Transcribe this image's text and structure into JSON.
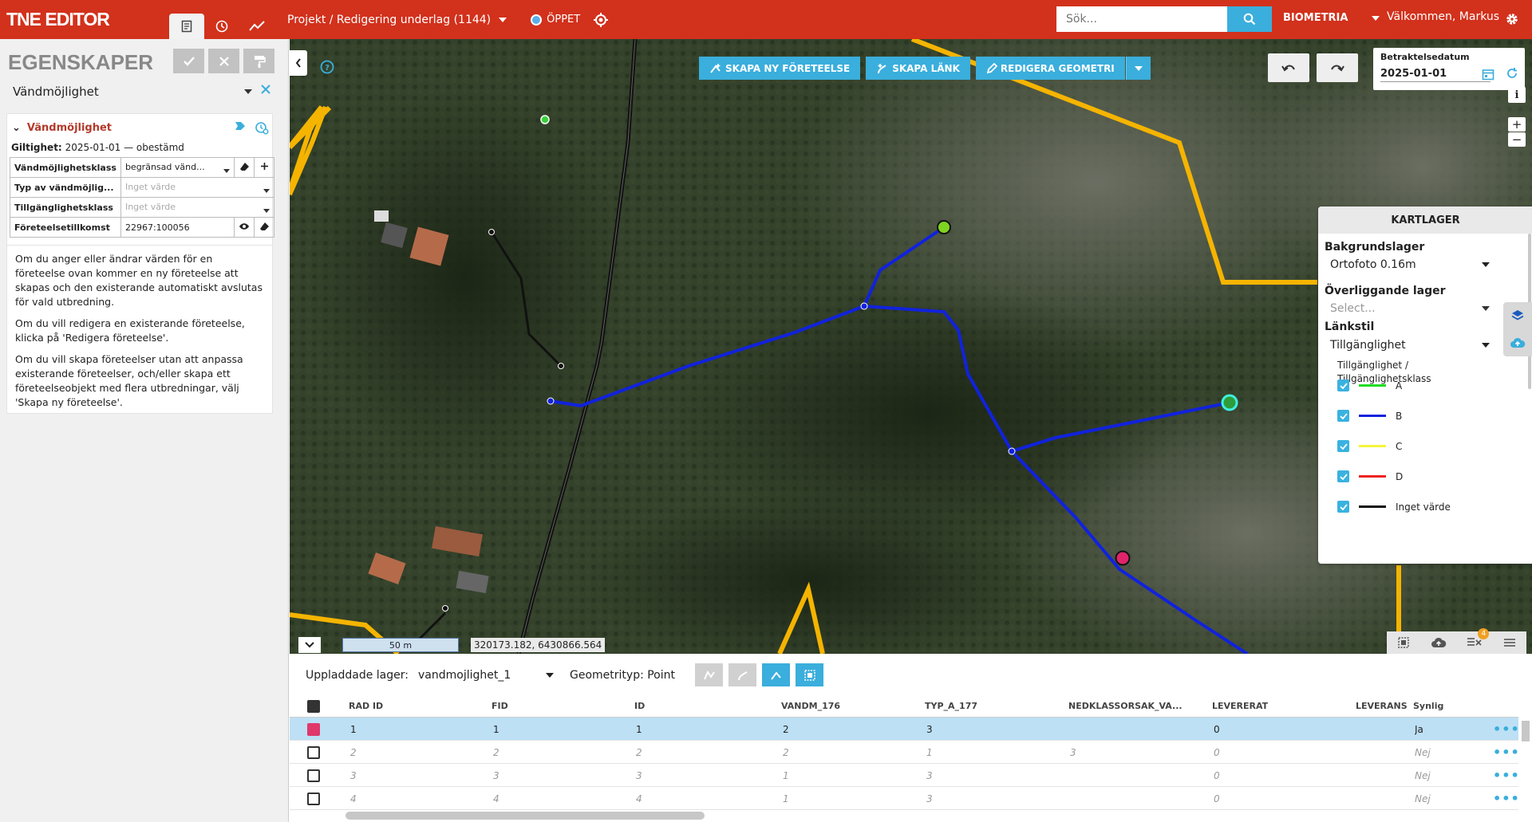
{
  "app": {
    "logo": "TNE EDITOR"
  },
  "header": {
    "project": "Projekt / Redigering underlag (1144)",
    "status": "ÖPPET",
    "search_placeholder": "Sök...",
    "org": "BIOMETRIA",
    "welcome": "Välkommen, Markus"
  },
  "panel": {
    "title": "EGENSKAPER",
    "type": "Vändmöjlighet",
    "section": "Vändmöjlighet",
    "validity_label": "Giltighet:",
    "validity_value": "2025-01-01 — obestämd",
    "props": [
      {
        "label": "Vändmöjlighetsklass",
        "value": "begränsad vänd..."
      },
      {
        "label": "Typ av vändmöjlig...",
        "value": "Inget värde"
      },
      {
        "label": "Tillgänglighetsklass",
        "value": "Inget värde"
      },
      {
        "label": "Företeelsetillkomst",
        "value": "22967:100056"
      }
    ],
    "info": [
      "Om du anger eller ändrar värden för en företeelse ovan kommer en ny företeelse att skapas och den existerande automatiskt avslutas för vald utbredning.",
      "Om du vill redigera en existerande företeelse, klicka på 'Redigera företeelse'.",
      "Om du vill skapa företeelser utan att anpassa existerande företeelser, och/eller skapa ett företeelseobjekt med flera utbredningar, välj 'Skapa ny företeelse'."
    ]
  },
  "toolbar": {
    "create_feature": "SKAPA NY FÖRETEELSE",
    "create_link": "SKAPA LÄNK",
    "edit_geometry": "REDIGERA GEOMETRI"
  },
  "date": {
    "label": "Betraktelsedatum",
    "value": "2025-01-01"
  },
  "layers": {
    "title": "KARTLAGER",
    "bg_label": "Bakgrundslager",
    "bg_value": "Ortofoto 0.16m",
    "overlay_label": "Överliggande lager",
    "overlay_placeholder": "Select...",
    "style_label": "Länkstil",
    "style_value": "Tillgänglighet",
    "legend_title1": "Tillgänglighet /",
    "legend_title2": "Tillgänglighetsklass",
    "legend": [
      {
        "label": "A",
        "color": "#22dd22"
      },
      {
        "label": "B",
        "color": "#1122dd"
      },
      {
        "label": "C",
        "color": "#f5f53a"
      },
      {
        "label": "D",
        "color": "#ee2222"
      },
      {
        "label": "Inget värde",
        "color": "#111111"
      }
    ]
  },
  "map": {
    "scale": "50 m",
    "coords": "320173.182, 6430866.564",
    "badge": "4"
  },
  "table": {
    "uploaded_label": "Uppladdade lager:",
    "uploaded_value": "vandmojlighet_1",
    "geom_label": "Geometrityp: Point",
    "columns": [
      "RAD ID",
      "FID",
      "ID",
      "VANDM_176",
      "TYP_A_177",
      "NEDKLASSORSAK_VA...",
      "LEVERERAT",
      "LEVERANS",
      "Synlig"
    ],
    "rows": [
      {
        "cells": [
          "1",
          "1",
          "1",
          "2",
          "3",
          "",
          "0",
          "",
          "Ja"
        ]
      },
      {
        "cells": [
          "2",
          "2",
          "2",
          "2",
          "1",
          "3",
          "0",
          "",
          "Nej"
        ]
      },
      {
        "cells": [
          "3",
          "3",
          "3",
          "1",
          "3",
          "",
          "0",
          "",
          "Nej"
        ]
      },
      {
        "cells": [
          "4",
          "4",
          "4",
          "1",
          "3",
          "",
          "0",
          "",
          "Nej"
        ]
      }
    ],
    "more": "•••"
  }
}
